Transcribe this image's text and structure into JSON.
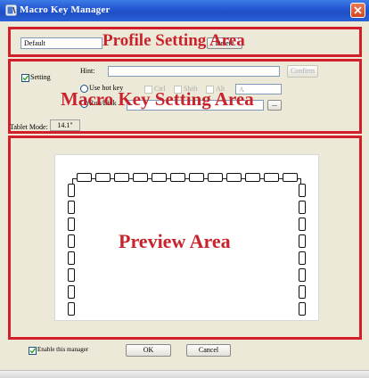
{
  "window": {
    "title": "Macro Key Manager"
  },
  "areas": {
    "profile": "Profile Setting Area",
    "macro": "Macro Key Setting Area",
    "preview": "Preview Area"
  },
  "profile": {
    "name": "Default",
    "button_label": "Delete"
  },
  "macro": {
    "setting_label": "Setting",
    "hint_label": "Hint:",
    "hint_value": "",
    "confirm_label": "Confirm",
    "use_hotkey_label": "Use hot key",
    "run_label": "Run/Link",
    "ctrl_label": "Ctrl",
    "shift_label": "Shift",
    "alt_label": "Alt",
    "key_value": "A",
    "browse_label": "..."
  },
  "tablet": {
    "label": "Tablet Mode:",
    "value": "14.1\""
  },
  "footer": {
    "enable_label": "Enable this manager",
    "ok_label": "OK",
    "cancel_label": "Cancel"
  },
  "colors": {
    "area_border": "#d31f2a",
    "area_text": "#c8232c",
    "title_bar": "#2458d2",
    "window_bg": "#ece9d8"
  },
  "icons": {
    "app": "tablet-app-icon",
    "close": "close-icon",
    "check": "checkmark-icon"
  }
}
